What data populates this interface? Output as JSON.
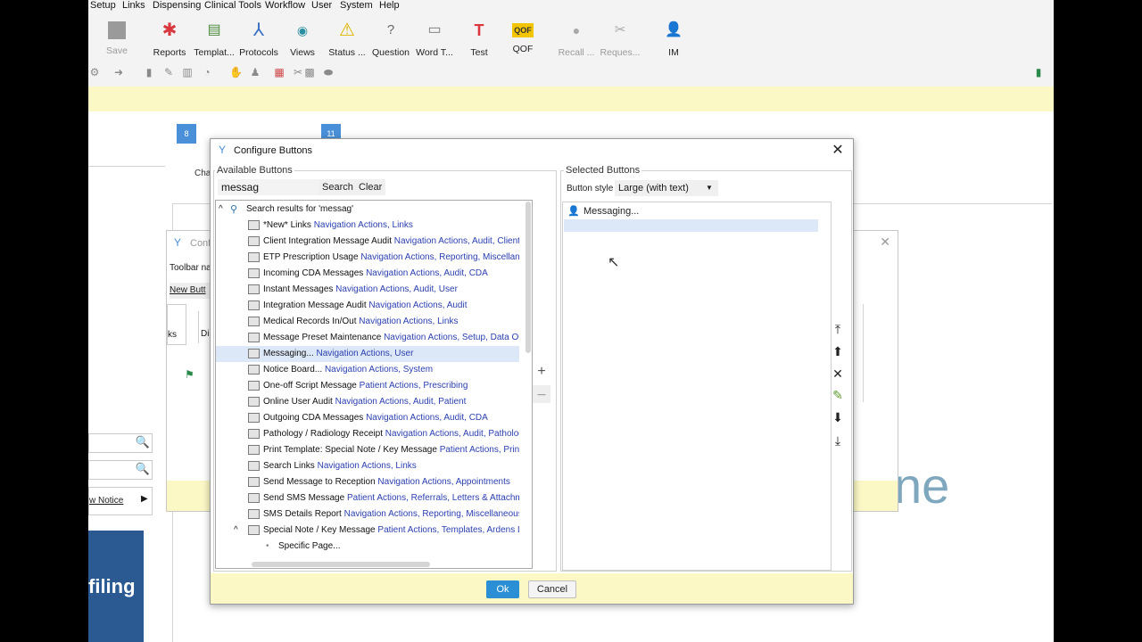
{
  "menu": [
    "Setup",
    "Links",
    "Dispensing",
    "Clinical Tools",
    "Workflow",
    "User",
    "System",
    "Help"
  ],
  "ribbon": [
    {
      "label": "Save",
      "icon": "save-icon",
      "disabled": true
    },
    {
      "label": "Reports",
      "icon": "reports-icon"
    },
    {
      "label": "Templat...",
      "icon": "template-icon"
    },
    {
      "label": "Protocols",
      "icon": "protocols-icon"
    },
    {
      "label": "Views",
      "icon": "eye-icon"
    },
    {
      "label": "Status ...",
      "icon": "warning-icon"
    },
    {
      "label": "Question",
      "icon": "question-icon"
    },
    {
      "label": "Word T...",
      "icon": "word-template-icon"
    },
    {
      "label": "Test",
      "icon": "test-icon",
      "glyph": "T"
    },
    {
      "label": "QOF",
      "icon": "qof-icon",
      "glyph": "QOF"
    },
    {
      "label": "Recall ...",
      "icon": "recall-icon",
      "disabled": true
    },
    {
      "label": "Reques...",
      "icon": "request-icon",
      "disabled": true
    },
    {
      "label": "IM",
      "icon": "im-icon"
    }
  ],
  "background": {
    "badge_a": "8",
    "badge_b": "11",
    "cha": "Cha",
    "ghost_title": "Conf",
    "toolbar_na": "Toolbar na",
    "new_butt": "New Butt",
    "ks": "ks",
    "di": "Di",
    "new_notice": "w Notice",
    "filing": "filing",
    "logo_text": "ne"
  },
  "dialog": {
    "title": "Configure Buttons",
    "available_label": "Available Buttons",
    "search_value": "messag",
    "search_button": "Search",
    "clear_button": "Clear",
    "selected_label": "Selected Buttons",
    "button_style_label": "Button style",
    "button_style_value": "Large (with text)",
    "selected_items": [
      "Messaging..."
    ],
    "ok": "Ok",
    "cancel": "Cancel",
    "tree_header": "Search results for 'messag'",
    "results": [
      {
        "name": "*New* Links",
        "cats": "Navigation Actions, Links"
      },
      {
        "name": "Client Integration Message Audit",
        "cats": "Navigation Actions, Audit, Client Int"
      },
      {
        "name": "ETP Prescription Usage",
        "cats": "Navigation Actions, Reporting, Miscellaneou"
      },
      {
        "name": "Incoming CDA Messages",
        "cats": "Navigation Actions, Audit, CDA"
      },
      {
        "name": "Instant Messages",
        "cats": "Navigation Actions, Audit, User"
      },
      {
        "name": "Integration Message Audit",
        "cats": "Navigation Actions, Audit"
      },
      {
        "name": "Medical Records In/Out",
        "cats": "Navigation Actions, Links"
      },
      {
        "name": "Message Preset Maintenance",
        "cats": "Navigation Actions, Setup, Data Outp"
      },
      {
        "name": "Messaging...",
        "cats": "Navigation Actions, User",
        "selected": true
      },
      {
        "name": "Notice Board...",
        "cats": "Navigation Actions, System"
      },
      {
        "name": "One-off Script Message",
        "cats": "Patient Actions, Prescribing"
      },
      {
        "name": "Online User Audit",
        "cats": "Navigation Actions, Audit, Patient"
      },
      {
        "name": "Outgoing CDA Messages",
        "cats": "Navigation Actions, Audit, CDA"
      },
      {
        "name": "Pathology / Radiology Receipt",
        "cats": "Navigation Actions, Audit, Pathology ."
      },
      {
        "name": "Print Template: Special Note / Key Message",
        "cats": "Patient Actions, Print Te"
      },
      {
        "name": "Search Links",
        "cats": "Navigation Actions, Links"
      },
      {
        "name": "Send Message to Reception",
        "cats": "Navigation Actions, Appointments"
      },
      {
        "name": "Send SMS Message",
        "cats": "Patient Actions, Referrals, Letters & Attachme"
      },
      {
        "name": "SMS Details Report",
        "cats": "Navigation Actions, Reporting, Miscellaneous Re"
      },
      {
        "name": "Special Note / Key Message",
        "cats": "Patient Actions, Templates, Ardens Ltd",
        "expanded": true
      }
    ],
    "sub_item": "Specific Page..."
  }
}
